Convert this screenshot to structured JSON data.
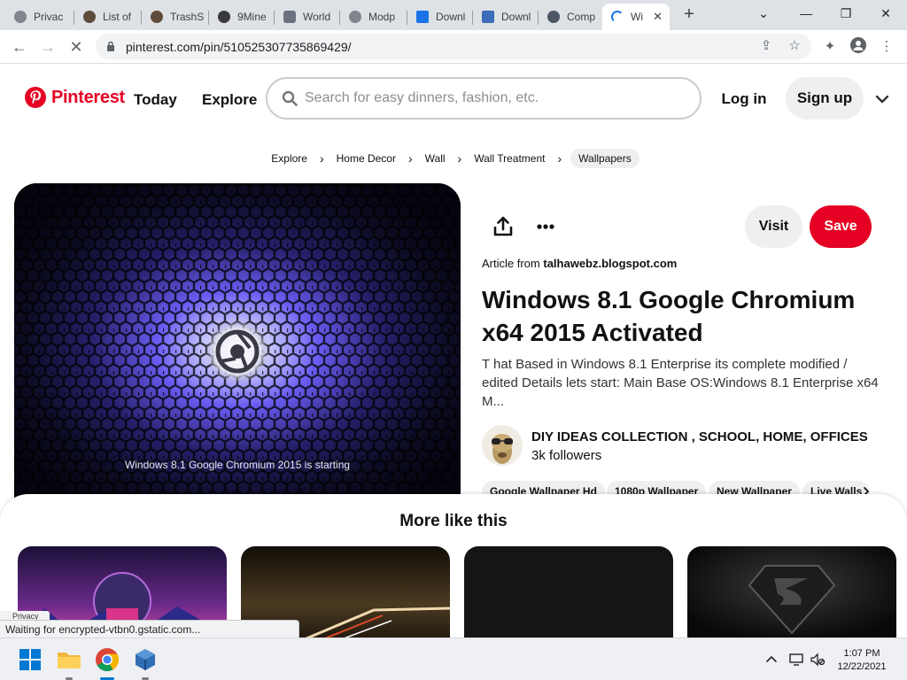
{
  "browser": {
    "tabs": [
      {
        "label": "Privac",
        "favicon": "globe-icon"
      },
      {
        "label": "List of",
        "favicon": "wikipedia-icon"
      },
      {
        "label": "TrashS",
        "favicon": "wikipedia-icon"
      },
      {
        "label": "9Mine",
        "favicon": "9mine-icon"
      },
      {
        "label": "World",
        "favicon": "shield-icon"
      },
      {
        "label": "Modp",
        "favicon": "globe-icon"
      },
      {
        "label": "Downl",
        "favicon": "download-icon"
      },
      {
        "label": "Downl",
        "favicon": "image-icon"
      },
      {
        "label": "Comp",
        "favicon": "gear-icon"
      },
      {
        "label": "Wi",
        "favicon": "loading-icon"
      }
    ],
    "url": "pinterest.com/pin/510525307735869429/",
    "accent": "#1a73e8"
  },
  "pinterest": {
    "brand": "Pinterest",
    "brand_color": "#e60023",
    "nav": {
      "today": "Today",
      "explore": "Explore"
    },
    "search_placeholder": "Search for easy dinners, fashion, etc.",
    "login": "Log in",
    "signup": "Sign up"
  },
  "breadcrumbs": [
    "Explore",
    "Home Decor",
    "Wall",
    "Wall Treatment",
    "Wallpapers"
  ],
  "pin": {
    "image_caption": "Windows 8.1 Google Chromium 2015 is starting",
    "visit": "Visit",
    "save": "Save",
    "article_prefix": "Article from",
    "article_source": "talhawebz.blogspot.com",
    "title": "Windows 8.1 Google Chromium x64 2015 Activated",
    "description": "T hat Based in Windows 8.1 Enterprise its complete modified / edited Details lets start: Main Base OS:Windows 8.1 Enterprise x64 M...",
    "creator": "DIY IDEAS COLLECTION , SCHOOL, HOME, OFFICES",
    "followers": "3k followers",
    "tags": [
      "Google Wallpaper Hd",
      "1080p Wallpaper",
      "New Wallpaper",
      "Live Walls"
    ]
  },
  "more_like_this": {
    "title": "More like this"
  },
  "status": {
    "privacy_label": "Privacy",
    "loading_text": "Waiting for encrypted-vtbn0.gstatic.com..."
  },
  "taskbar": {
    "time": "1:07 PM",
    "date": "12/22/2021"
  }
}
